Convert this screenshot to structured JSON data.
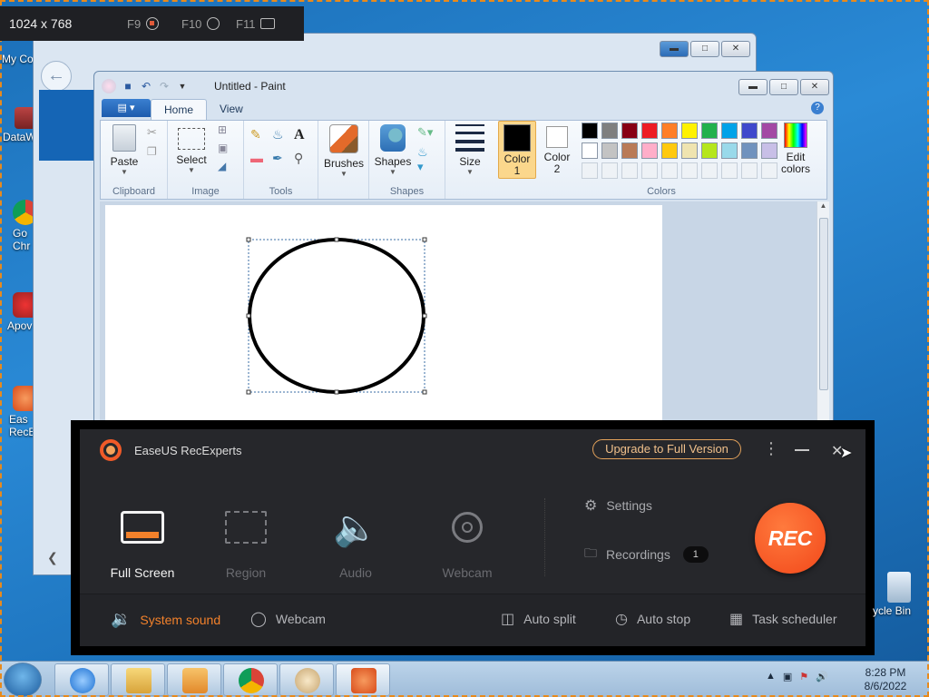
{
  "capture_bar": {
    "dimensions": "1024 x 768",
    "keys": [
      {
        "label": "F9",
        "icon": "record-icon"
      },
      {
        "label": "F10",
        "icon": "pause-icon"
      },
      {
        "label": "F11",
        "icon": "screenshot-icon"
      }
    ]
  },
  "desktop": {
    "icons": [
      {
        "label": "My Co"
      },
      {
        "label": "DataW"
      },
      {
        "label": "Go\nChr"
      },
      {
        "label": "Apov"
      },
      {
        "label": "Eas\nRecE"
      },
      {
        "label": "ycle Bin"
      }
    ]
  },
  "paint": {
    "title": "Untitled - Paint",
    "tabs": [
      {
        "label": "Home"
      },
      {
        "label": "View"
      }
    ],
    "groups": {
      "clipboard": {
        "label": "Clipboard",
        "paste": "Paste"
      },
      "image": {
        "label": "Image",
        "select": "Select"
      },
      "tools": {
        "label": "Tools"
      },
      "brushes": {
        "label": "Brushes"
      },
      "shapes": {
        "label": "Shapes",
        "shapes_btn": "Shapes"
      },
      "size": {
        "label": "Size"
      },
      "colors": {
        "label": "Colors",
        "color1": "Color\n1",
        "color2": "Color\n2",
        "edit": "Edit\ncolors"
      }
    },
    "palette_row1": [
      "#000000",
      "#7f7f7f",
      "#880015",
      "#ed1c24",
      "#ff7f27",
      "#fff200",
      "#22b14c",
      "#00a2e8",
      "#3f48cc",
      "#a349a4"
    ],
    "palette_row2": [
      "#ffffff",
      "#c3c3c3",
      "#b97a57",
      "#ffaec9",
      "#ffc90e",
      "#efe4b0",
      "#b5e61d",
      "#99d9ea",
      "#7092be",
      "#c8bfe7"
    ]
  },
  "easeus": {
    "app_name": "EaseUS RecExperts",
    "upgrade": "Upgrade to Full Version",
    "modes": [
      {
        "label": "Full Screen",
        "active": true
      },
      {
        "label": "Region",
        "active": false
      },
      {
        "label": "Audio",
        "active": false
      },
      {
        "label": "Webcam",
        "active": false
      }
    ],
    "settings": "Settings",
    "recordings": "Recordings",
    "recordings_count": "1",
    "rec_button": "REC",
    "footer": {
      "system_sound": "System sound",
      "webcam": "Webcam",
      "auto_split": "Auto split",
      "auto_stop": "Auto stop",
      "task_scheduler": "Task scheduler"
    },
    "accent_color": "#f2812b"
  },
  "taskbar": {
    "time": "8:28 PM",
    "date": "8/6/2022"
  }
}
